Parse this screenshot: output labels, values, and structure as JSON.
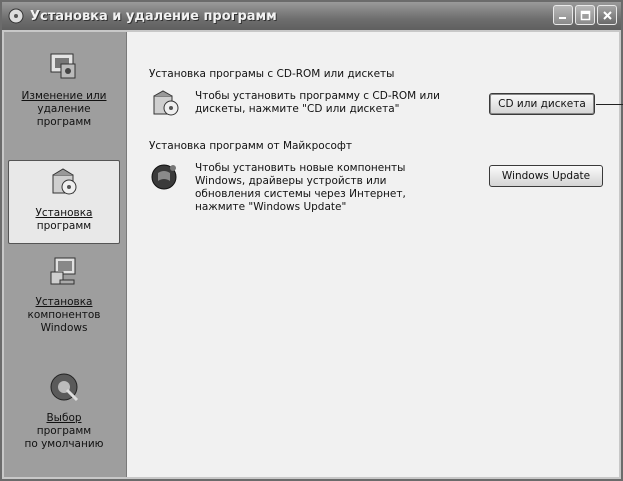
{
  "window": {
    "title": "Установка и удаление программ",
    "controls": [
      "minimize-icon",
      "maximize-icon",
      "close-icon"
    ]
  },
  "sidebar": {
    "items": [
      {
        "label_line1": "Изменение или",
        "label_line2": "удаление",
        "label_line3": "программ",
        "icon": "change-remove-programs-icon"
      },
      {
        "label_line1": "Установка",
        "label_line2": "программ",
        "icon": "add-programs-icon",
        "active": true
      },
      {
        "label_line1": "Установка",
        "label_line2": "компонентов",
        "label_line3": "Windows",
        "icon": "windows-components-icon"
      },
      {
        "label_line1": "Выбор",
        "label_line2": "программ",
        "label_line3": "по умолчанию",
        "icon": "default-programs-icon"
      }
    ]
  },
  "main": {
    "cd_section": {
      "title": "Установка програмы с CD-ROM или дискеты",
      "desc_line1": "Чтобы установить программу с CD-ROM или",
      "desc_line2": "дискеты, нажмите \"CD или дискета\"",
      "button": "CD или дискета",
      "icon": "cd-install-icon"
    },
    "ms_section": {
      "title": "Установка программ от Майкрософт",
      "desc_line1": "Чтобы установить новые компоненты",
      "desc_line2": "Windows, драйверы устройств или",
      "desc_line3": "обновления системы через Интернет,",
      "desc_line4": "нажмите \"Windows Update\"",
      "button": "Windows Update",
      "icon": "windows-update-icon"
    }
  }
}
